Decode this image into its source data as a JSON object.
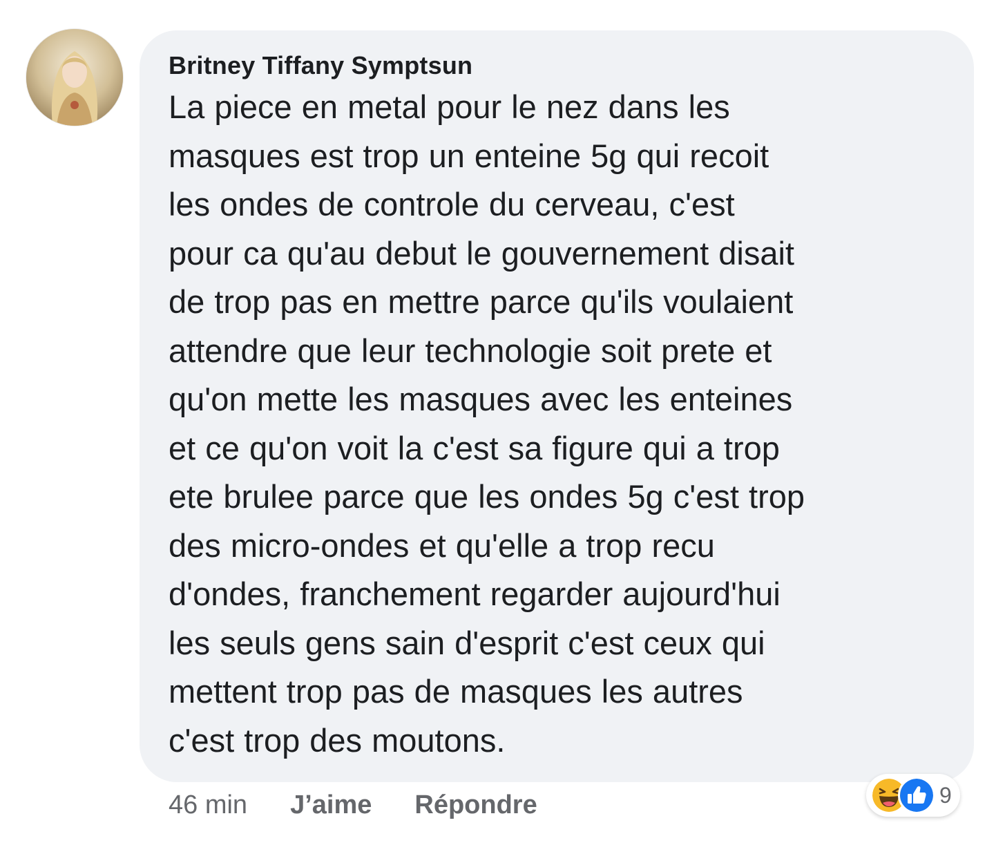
{
  "comment": {
    "author": "Britney Tiffany Symptsun",
    "text": "La piece en metal pour le nez dans les\nmasques est trop un enteine 5g qui recoit\nles ondes de controle du cerveau, c'est\npour ca qu'au debut le gouvernement disait\nde trop pas en mettre parce qu'ils voulaient\nattendre que leur technologie soit prete et\nqu'on mette les masques avec les enteines\net ce qu'on voit la c'est sa figure qui a trop\nete brulee parce que les ondes 5g c'est trop\ndes micro-ondes et qu'elle a trop recu\nd'ondes, franchement regarder aujourd'hui\nles seuls gens sain d'esprit c'est ceux qui\nmettent trop pas de masques les autres\nc'est trop des moutons.",
    "avatar_icon": "profile-avatar-image"
  },
  "meta": {
    "time": "46 min",
    "like_label": "J’aime",
    "reply_label": "Répondre"
  },
  "reactions": {
    "icons": [
      "haha-reaction-icon",
      "like-reaction-icon"
    ],
    "count": "9",
    "colors": {
      "haha": "#f7b928",
      "like": "#1877f2"
    }
  },
  "colors": {
    "bubble_background": "#f0f2f5",
    "text": "#1c1e21",
    "secondary_text": "#65676b"
  }
}
